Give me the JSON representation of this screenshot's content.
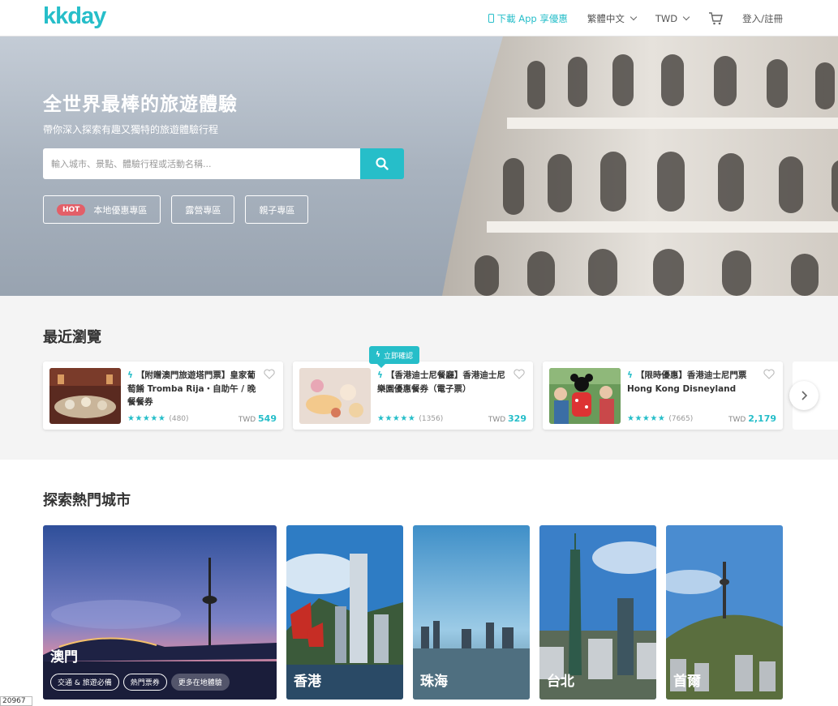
{
  "nav": {
    "logo": "kkday",
    "app_link": "下載 App 享優惠",
    "language": "繁體中文",
    "currency": "TWD",
    "login": "登入/註冊"
  },
  "hero": {
    "title": "全世界最棒的旅遊體驗",
    "subtitle": "帶你深入探索有趣又獨特的旅遊體驗行程",
    "search_placeholder": "輸入城市、景點、體驗行程或活動名稱...",
    "chips": [
      {
        "badge": "HOT",
        "label": "本地優惠專區"
      },
      {
        "label": "露營專區"
      },
      {
        "label": "親子專區"
      }
    ]
  },
  "recent": {
    "title": "最近瀏覽",
    "badge": "立即確認",
    "cards": [
      {
        "title": "【附贈澳門旅遊塔門票】皇家葡萄餚 Tromba Rija・自助午 / 晚餐餐券",
        "rating": 4.5,
        "count": "(480)",
        "currency": "TWD",
        "price": "549"
      },
      {
        "title": "【香港迪士尼餐廳】香港迪士尼樂園優惠餐券（電子票）",
        "rating": 4.5,
        "count": "(1356)",
        "currency": "TWD",
        "price": "329"
      },
      {
        "title": "【限時優惠】香港迪士尼門票 Hong Kong Disneyland",
        "rating": 4.5,
        "count": "(7665)",
        "currency": "TWD",
        "price": "2,179"
      }
    ]
  },
  "cities": {
    "title": "探索熱門城市",
    "items": [
      {
        "name": "澳門",
        "tags": [
          "交通 & 旅遊必備",
          "熱門票券",
          "更多在地體驗"
        ]
      },
      {
        "name": "香港"
      },
      {
        "name": "珠海"
      },
      {
        "name": "台北"
      },
      {
        "name": "首爾"
      }
    ]
  },
  "corner_label": "20967",
  "colors": {
    "accent": "#26bec9",
    "hot": "#e35f68"
  }
}
